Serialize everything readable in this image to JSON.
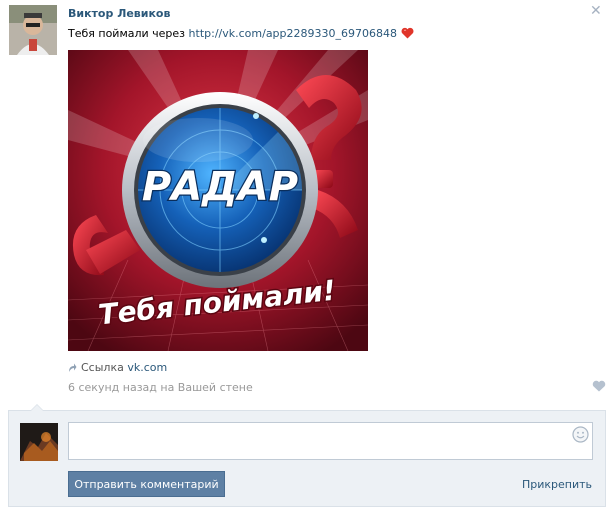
{
  "post": {
    "author": "Виктор Левиков",
    "text_prefix": "Тебя поймали через ",
    "link": "http://vk.com/app2289330_69706848",
    "image": {
      "logo_text": "РАДАР",
      "caption": "Тебя поймали!"
    },
    "source_label": "Ссылка ",
    "source_link": "vk.com",
    "timestamp": "6 секунд назад на Вашей стене"
  },
  "comment": {
    "placeholder": "",
    "send_label": "Отправить комментарий",
    "attach_label": "Прикрепить"
  },
  "colors": {
    "link": "#2b587a",
    "button": "#5e80a4",
    "comment_bg": "#edf1f5",
    "heart_red": "#e0352a"
  },
  "icons": [
    "close-icon",
    "heart-icon",
    "share-arrow-icon",
    "like-heart-icon",
    "smile-icon"
  ]
}
